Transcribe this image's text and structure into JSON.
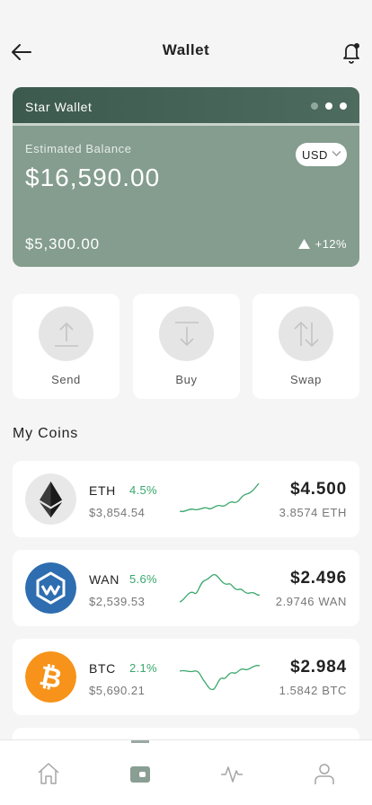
{
  "header": {
    "title": "Wallet"
  },
  "card": {
    "wallet_name": "Star Wallet",
    "estimated_label": "Estimated Balance",
    "balance": "$16,590.00",
    "currency": "USD",
    "sub_balance": "$5,300.00",
    "change": "+12%",
    "page_count": 3,
    "active_page": 2
  },
  "actions": [
    {
      "label": "Send",
      "icon": "upload-icon"
    },
    {
      "label": "Buy",
      "icon": "download-icon"
    },
    {
      "label": "Swap",
      "icon": "swap-icon"
    }
  ],
  "section_title": "My Coins",
  "coins": [
    {
      "symbol": "ETH",
      "pct": "4.5%",
      "fiat": "$3,854.54",
      "price": "$4.500",
      "qty": "3.8574 ETH",
      "icon": "ethereum-icon"
    },
    {
      "symbol": "WAN",
      "pct": "5.6%",
      "fiat": "$2,539.53",
      "price": "$2.496",
      "qty": "2.9746 WAN",
      "icon": "wanchain-icon"
    },
    {
      "symbol": "BTC",
      "pct": "2.1%",
      "fiat": "$5,690.21",
      "price": "$2.984",
      "qty": "1.5842 BTC",
      "icon": "bitcoin-icon"
    }
  ],
  "colors": {
    "accent": "#3aa76d",
    "card_header": "#3d5a4f",
    "card_body": "#849d8e",
    "eth_bg": "#e8e8e8",
    "wan_bg": "#2e6db0",
    "btc_bg": "#f7931a"
  },
  "tabs": [
    {
      "icon": "home-icon"
    },
    {
      "icon": "wallet-icon",
      "active": true
    },
    {
      "icon": "activity-icon"
    },
    {
      "icon": "profile-icon"
    }
  ]
}
